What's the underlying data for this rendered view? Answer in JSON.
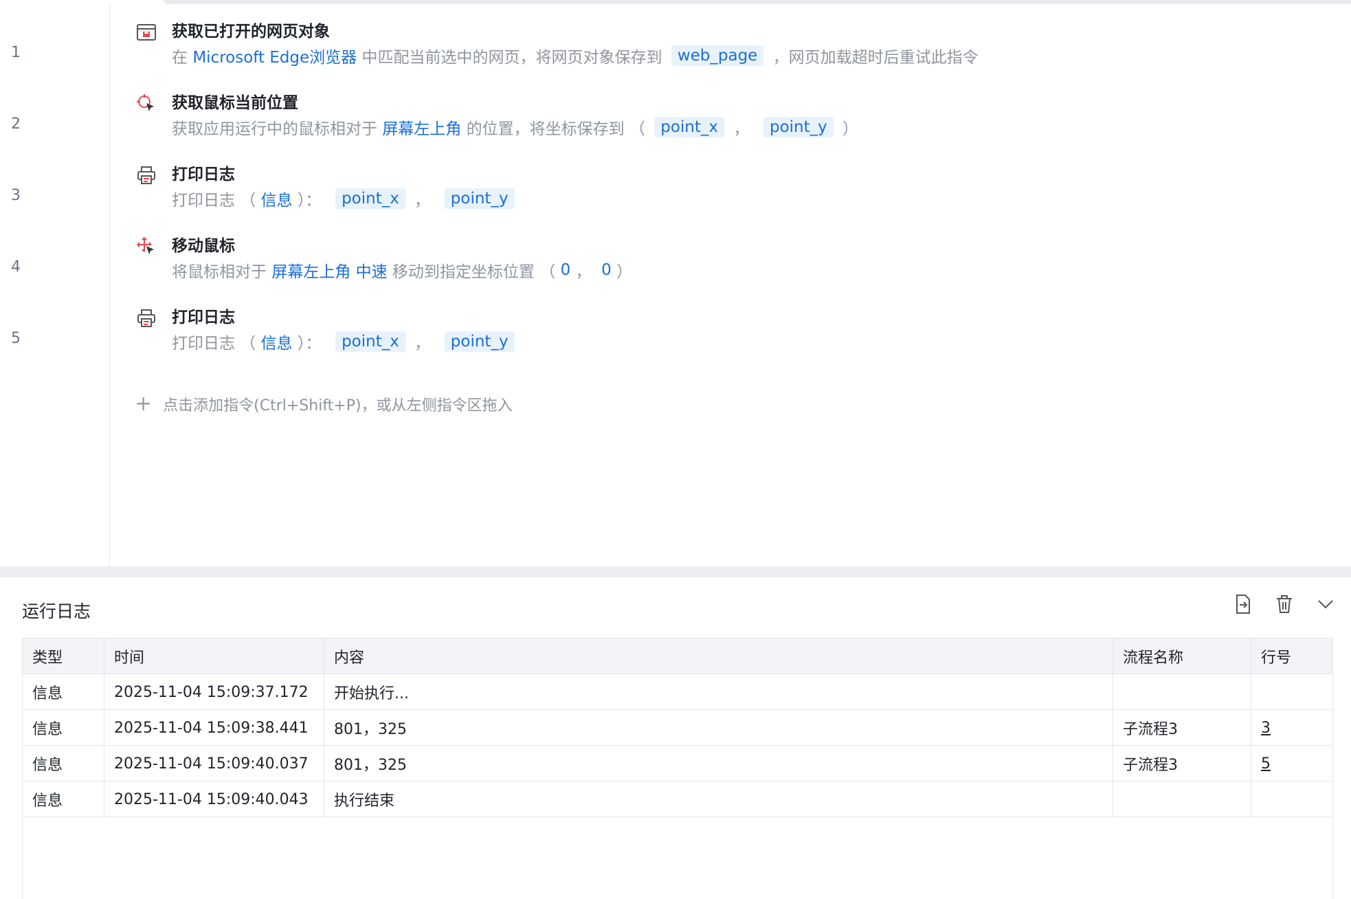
{
  "editor": {
    "steps": [
      {
        "line": "1",
        "icon": "browser-page-icon",
        "title": "获取已打开的网页对象",
        "desc": [
          {
            "t": "在 ",
            "k": "plain"
          },
          {
            "t": "Microsoft Edge浏览器",
            "k": "kw"
          },
          {
            "t": " 中匹配当前选中的网页，将网页对象保存到 ",
            "k": "plain"
          },
          {
            "t": "web_page",
            "k": "chip"
          },
          {
            "t": " ，网页加载超时后重试此指令",
            "k": "plain"
          }
        ]
      },
      {
        "line": "2",
        "icon": "mouse-position-icon",
        "title": "获取鼠标当前位置",
        "desc": [
          {
            "t": "获取应用运行中的鼠标相对于 ",
            "k": "plain"
          },
          {
            "t": "屏幕左上角",
            "k": "kw"
          },
          {
            "t": " 的位置，将坐标保存到 （ ",
            "k": "plain"
          },
          {
            "t": "point_x",
            "k": "chip"
          },
          {
            "t": " ，  ",
            "k": "plain"
          },
          {
            "t": "point_y",
            "k": "chip"
          },
          {
            "t": " ）",
            "k": "plain"
          }
        ]
      },
      {
        "line": "3",
        "icon": "print-log-icon",
        "title": "打印日志",
        "desc": [
          {
            "t": "打印日志 （ ",
            "k": "plain"
          },
          {
            "t": "信息",
            "k": "kw"
          },
          {
            "t": " ）：  ",
            "k": "plain"
          },
          {
            "t": "point_x",
            "k": "chip"
          },
          {
            "t": " ，  ",
            "k": "plain"
          },
          {
            "t": "point_y",
            "k": "chip"
          }
        ]
      },
      {
        "line": "4",
        "icon": "move-mouse-icon",
        "title": "移动鼠标",
        "desc": [
          {
            "t": "将鼠标相对于 ",
            "k": "plain"
          },
          {
            "t": "屏幕左上角",
            "k": "kw"
          },
          {
            "t": " ",
            "k": "plain"
          },
          {
            "t": "中速",
            "k": "kw"
          },
          {
            "t": " 移动到指定坐标位置 （ ",
            "k": "plain"
          },
          {
            "t": "0",
            "k": "kw"
          },
          {
            "t": " ，  ",
            "k": "plain"
          },
          {
            "t": "0",
            "k": "kw"
          },
          {
            "t": " ）",
            "k": "plain"
          }
        ]
      },
      {
        "line": "5",
        "icon": "print-log-icon",
        "title": "打印日志",
        "desc": [
          {
            "t": "打印日志 （ ",
            "k": "plain"
          },
          {
            "t": "信息",
            "k": "kw"
          },
          {
            "t": " ）：  ",
            "k": "plain"
          },
          {
            "t": "point_x",
            "k": "chip"
          },
          {
            "t": " ，  ",
            "k": "plain"
          },
          {
            "t": "point_y",
            "k": "chip"
          }
        ]
      }
    ],
    "add_hint": "点击添加指令(Ctrl+Shift+P)，或从左侧指令区拖入"
  },
  "log": {
    "title": "运行日志",
    "actions": [
      "export-icon",
      "trash-icon",
      "chevron-down-icon"
    ],
    "columns": [
      "类型",
      "时间",
      "内容",
      "流程名称",
      "行号"
    ],
    "rows": [
      {
        "type": "信息",
        "time": "2025-11-04 15:09:37.172",
        "content": "开始执行...",
        "flow": "",
        "line": ""
      },
      {
        "type": "信息",
        "time": "2025-11-04 15:09:38.441",
        "content": "801，325",
        "flow": "子流程3",
        "line": "3"
      },
      {
        "type": "信息",
        "time": "2025-11-04 15:09:40.037",
        "content": "801，325",
        "flow": "子流程3",
        "line": "5"
      },
      {
        "type": "信息",
        "time": "2025-11-04 15:09:40.043",
        "content": "执行结束",
        "flow": "",
        "line": ""
      }
    ]
  },
  "colors": {
    "accent": "#1a6fd6",
    "chip_bg": "#e8f2fd",
    "muted_text": "#8f959e",
    "icon_red": "#e5484d"
  }
}
